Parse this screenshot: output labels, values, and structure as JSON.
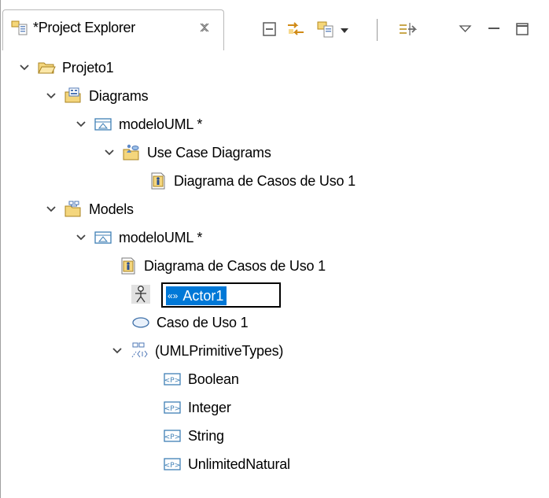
{
  "view": {
    "tab_title": "*Project Explorer",
    "tab_icon": "project-explorer-icon",
    "tab_close_icon": "close-icon",
    "toolbar": [
      "collapse-all-icon",
      "link-with-editor-icon",
      "new-icon",
      "dropdown-arrow-icon",
      "filter-icon",
      "view-menu-icon",
      "minimize-icon",
      "maximize-icon"
    ]
  },
  "tree": {
    "items": [
      {
        "label": "Projeto1",
        "icon": "project-folder-icon",
        "expanded": true
      },
      {
        "label": "Diagrams",
        "icon": "diagrams-folder-icon",
        "expanded": true
      },
      {
        "label": "modeloUML *",
        "icon": "model-icon",
        "expanded": true
      },
      {
        "label": "Use Case Diagrams",
        "icon": "use-case-diagrams-folder-icon",
        "expanded": true
      },
      {
        "label": "Diagrama de Casos de Uso 1",
        "icon": "diagram-icon"
      },
      {
        "label": "Models",
        "icon": "models-folder-icon",
        "expanded": true
      },
      {
        "label": "modeloUML *",
        "icon": "model-icon",
        "expanded": true
      },
      {
        "label": "Diagrama de Casos de Uso 1",
        "icon": "diagram-icon"
      },
      {
        "label": "Actor1",
        "icon": "actor-icon",
        "stereotype_marker": "«»",
        "editing": true
      },
      {
        "label": "Caso de Uso 1",
        "icon": "use-case-icon"
      },
      {
        "label": "(UMLPrimitiveTypes)",
        "icon": "package-import-icon",
        "expanded": true
      },
      {
        "label": "Boolean",
        "icon": "primitive-type-icon"
      },
      {
        "label": "Integer",
        "icon": "primitive-type-icon"
      },
      {
        "label": "String",
        "icon": "primitive-type-icon"
      },
      {
        "label": "UnlimitedNatural",
        "icon": "primitive-type-icon"
      }
    ]
  }
}
